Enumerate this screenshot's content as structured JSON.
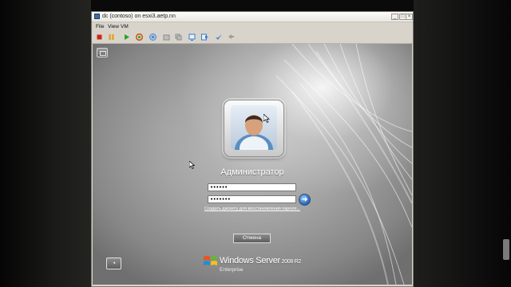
{
  "window": {
    "title": "dc (contoso) on esxi3.aetp.nn",
    "minimize_glyph": "_",
    "maximize_glyph": "□",
    "close_glyph": "×"
  },
  "menu": [
    {
      "label": "File"
    },
    {
      "label": "View"
    },
    {
      "label": "VM"
    }
  ],
  "toolbar": {
    "buttons": [
      {
        "icon": "stop-icon",
        "color": "#cc2a12"
      },
      {
        "icon": "pause-icon",
        "color": "#e0a010"
      },
      {
        "icon": "play-icon",
        "color": "#2aa12a"
      },
      {
        "icon": "reset-icon",
        "color": "#cc5a1a"
      },
      {
        "icon": "snapshot-icon",
        "color": "#5a86c8"
      },
      {
        "icon": "revert-icon",
        "color": "#8a8a8a"
      },
      {
        "icon": "snapshot-manager-icon",
        "color": "#8a8a8a"
      },
      {
        "icon": "network-icon",
        "color": "#3a7ac8"
      },
      {
        "icon": "console-icon",
        "color": "#3a7ac8"
      },
      {
        "icon": "settings-icon",
        "color": "#5a8ad0"
      },
      {
        "icon": "fullscreen-icon",
        "color": "#8a8a8a"
      }
    ]
  },
  "login": {
    "user_name": "Администратор",
    "password_mask": "••••••",
    "confirm_mask": "•••••••",
    "reset_link": "Создать дискету для восстановления пароля...",
    "cancel_label": "Отмена",
    "brand": "Windows Server",
    "brand_version": "2008",
    "brand_suffix": "R2",
    "edition": "Enterprise"
  },
  "colors": {
    "screen_bg": "#9e9e9e",
    "go_button": "#2f6fc1"
  }
}
